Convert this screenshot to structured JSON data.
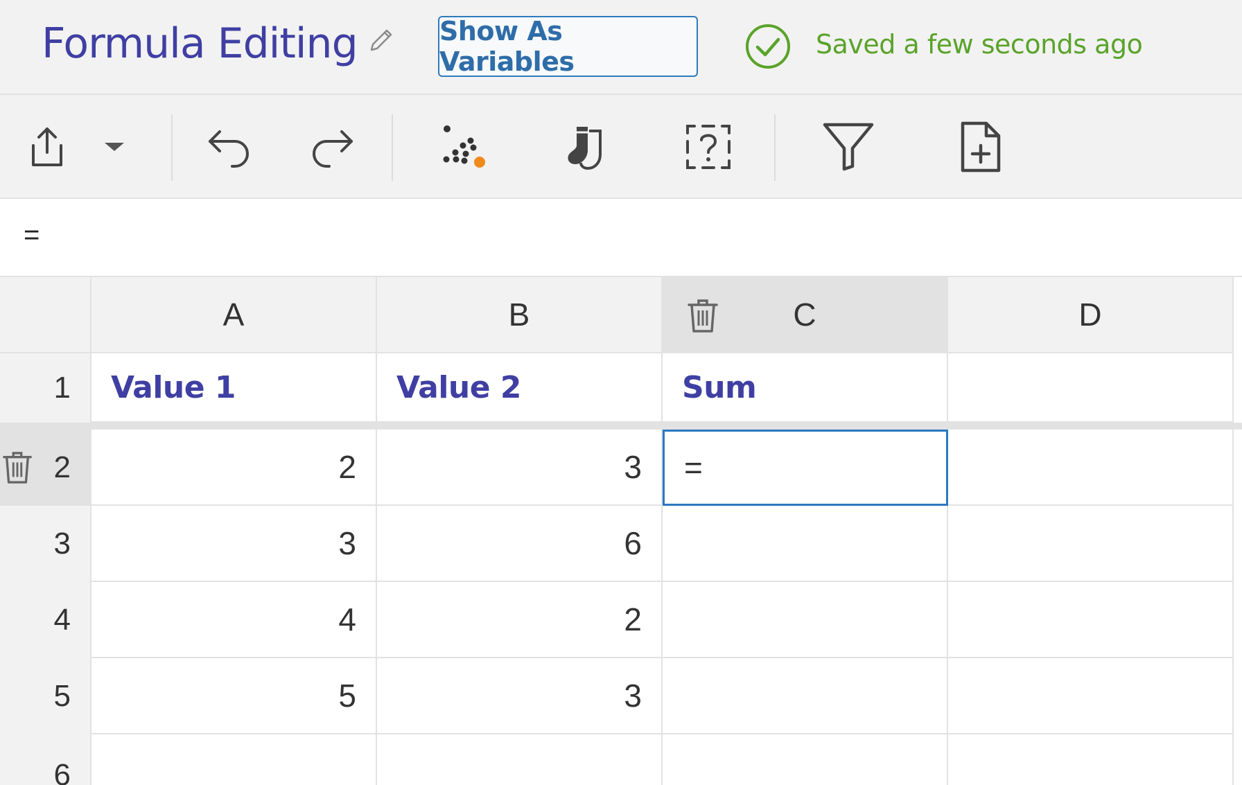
{
  "header": {
    "title": "Formula Editing",
    "show_vars_label": "Show As Variables",
    "saved_text": "Saved a few seconds ago",
    "saved_color": "#5aa32a",
    "title_color": "#3f3fa3"
  },
  "toolbar": {
    "items": [
      "share-icon",
      "dropdown-caret-icon",
      "undo-icon",
      "redo-icon",
      "scatter-plot-icon",
      "socks-icon",
      "help-box-icon",
      "filter-icon",
      "add-file-icon"
    ]
  },
  "formula_bar": {
    "value": "="
  },
  "grid": {
    "columns": [
      "A",
      "B",
      "C",
      "D"
    ],
    "selected_column": "C",
    "rows": [
      {
        "num": "1",
        "cells": [
          "Value 1",
          "Value 2",
          "Sum",
          ""
        ]
      },
      {
        "num": "2",
        "cells": [
          "2",
          "3",
          "=",
          ""
        ]
      },
      {
        "num": "3",
        "cells": [
          "3",
          "6",
          "",
          ""
        ]
      },
      {
        "num": "4",
        "cells": [
          "4",
          "2",
          "",
          ""
        ]
      },
      {
        "num": "5",
        "cells": [
          "5",
          "3",
          "",
          ""
        ]
      },
      {
        "num": "6",
        "cells": [
          "",
          "",
          "",
          ""
        ]
      }
    ],
    "active_cell": "C2"
  }
}
